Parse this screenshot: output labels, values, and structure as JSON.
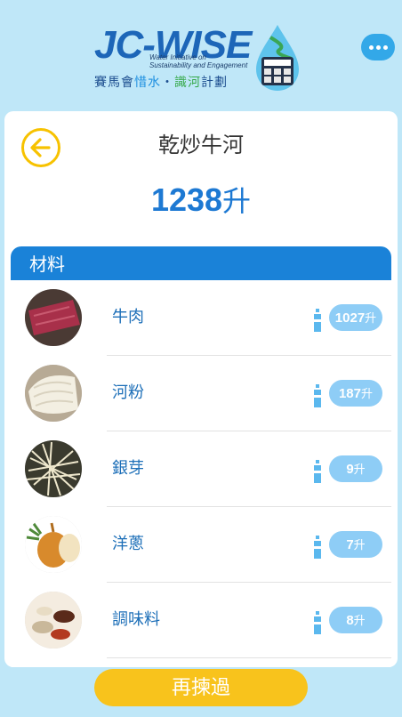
{
  "header": {
    "logo_main": "JC-WISE",
    "logo_sub_line1": "Water Initiative on",
    "logo_sub_line2": "Sustainability and Engagement",
    "logo_cn_1": "賽馬會",
    "logo_cn_2": "惜水",
    "logo_cn_3": "・",
    "logo_cn_4": "識河",
    "logo_cn_5": "計劃",
    "more_icon": "more-dots-icon"
  },
  "dish": {
    "name": "乾炒牛河",
    "total_value": "1238",
    "total_unit": "升"
  },
  "ingredients": {
    "section_title": "材料",
    "items": [
      {
        "name": "牛肉",
        "value": "1027",
        "unit": "升",
        "icon": "beef-photo"
      },
      {
        "name": "河粉",
        "value": "187",
        "unit": "升",
        "icon": "rice-noodle-photo"
      },
      {
        "name": "銀芽",
        "value": "9",
        "unit": "升",
        "icon": "bean-sprouts-photo"
      },
      {
        "name": "洋蔥",
        "value": "7",
        "unit": "升",
        "icon": "onion-photo"
      },
      {
        "name": "調味料",
        "value": "8",
        "unit": "升",
        "icon": "seasoning-photo"
      }
    ]
  },
  "actions": {
    "retry_label": "再揀過"
  },
  "colors": {
    "accent_blue": "#1a82d8",
    "badge_blue": "#8ecdf6",
    "yellow": "#f8c31c",
    "background": "#bfe7f8"
  }
}
